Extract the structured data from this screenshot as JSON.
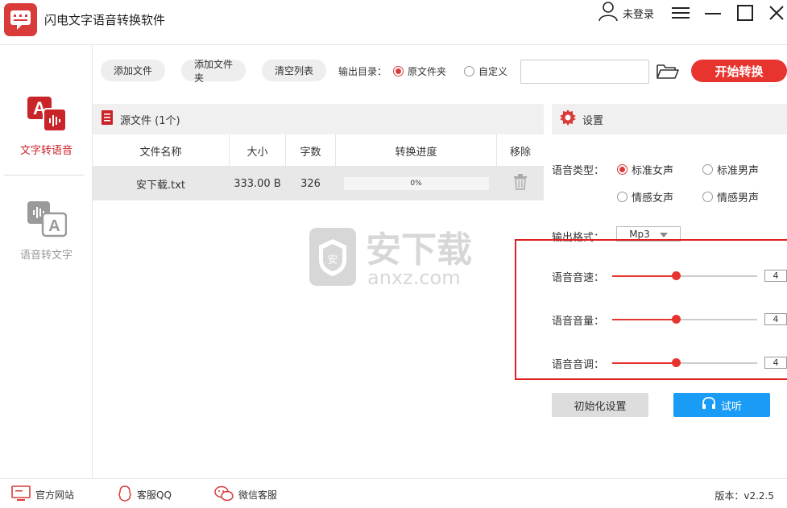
{
  "window": {
    "title": "闪电文字语音转换软件",
    "user_label": "未登录"
  },
  "sidebar": {
    "items": [
      {
        "label": "文字转语音",
        "active": true
      },
      {
        "label": "语音转文字",
        "active": false
      }
    ]
  },
  "toolbar": {
    "add_file": "添加文件",
    "add_folder": "添加文件夹",
    "clear_list": "清空列表",
    "output_dir_label": "输出目录：",
    "option_source": "原文件夹",
    "option_custom": "自定义",
    "path_value": "",
    "start": "开始转换"
  },
  "files": {
    "header": "源文件 (1个)",
    "columns": [
      "文件名称",
      "大小",
      "字数",
      "转换进度",
      "移除"
    ],
    "rows": [
      {
        "name": "安下载.txt",
        "size": "333.00 B",
        "chars": "326",
        "progress_text": "0%",
        "progress": 0
      }
    ]
  },
  "settings": {
    "header": "设置",
    "voice_type_label": "语音类型：",
    "voices": [
      "标准女声",
      "标准男声",
      "情感女声",
      "情感男声"
    ],
    "voice_selected": "标准女声",
    "format_label": "输出格式：",
    "format_value": "Mp3",
    "speed_label": "语音音速：",
    "speed_value": "4",
    "volume_label": "语音音量：",
    "volume_value": "4",
    "pitch_label": "语音音调：",
    "pitch_value": "4",
    "slider_level": 0.44,
    "reset": "初始化设置",
    "listen": "试听"
  },
  "watermark": {
    "text_cn": "安下载",
    "text_en": "anxz.com"
  },
  "footer": {
    "website": "官方网站",
    "qq": "客服QQ",
    "wechat": "微信客服",
    "version": "版本：v2.2.5"
  },
  "colors": {
    "accent": "#e8342f",
    "brand": "#d93a3a",
    "listen": "#1a9bf5",
    "highlight_box": "#e02020"
  }
}
